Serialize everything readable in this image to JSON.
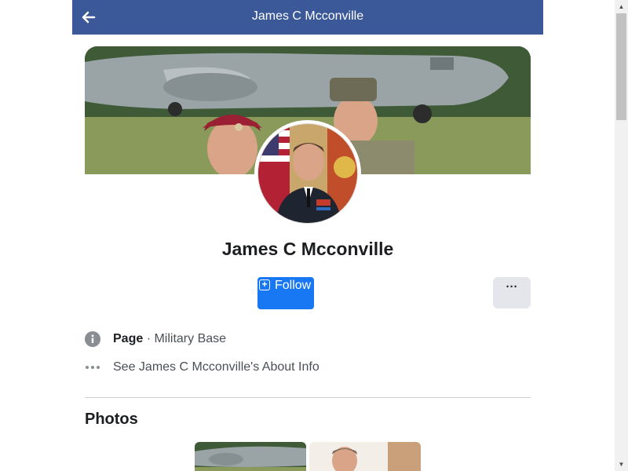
{
  "header": {
    "title": "James C Mcconville",
    "back_icon": "arrow-left-icon",
    "background": "#3b5998"
  },
  "profile": {
    "name": "James C Mcconville"
  },
  "actions": {
    "follow_label": "Follow",
    "follow_icon": "plus-square-icon",
    "more_label": "···",
    "accent": "#1877f2"
  },
  "info": {
    "page_label": "Page",
    "page_category": " · Military Base",
    "about_link": "See James C Mcconville's About Info",
    "info_icon": "info-circle-icon",
    "dots_icon": "more-dots-icon"
  },
  "photos": {
    "title": "Photos"
  },
  "scrollbar": {
    "up_arrow": "▲",
    "down_arrow": "▼"
  }
}
